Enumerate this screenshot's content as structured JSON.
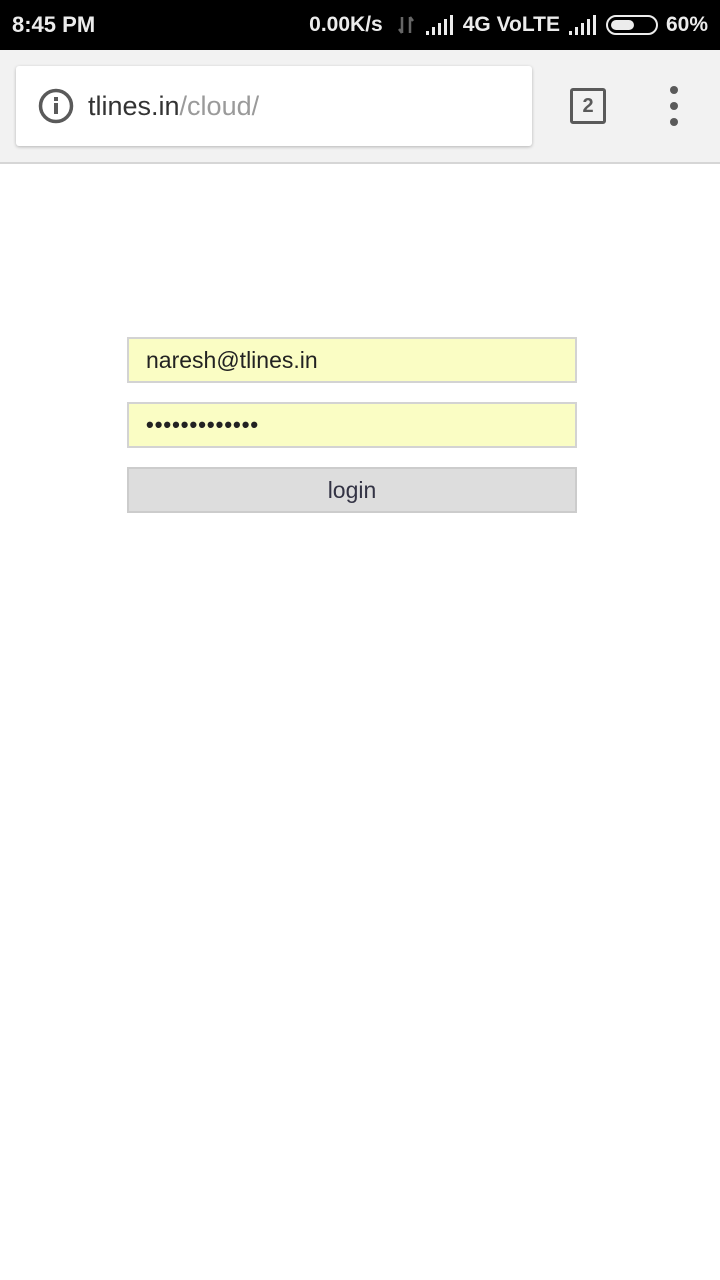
{
  "status_bar": {
    "time": "8:45 PM",
    "net_speed": "0.00K/s",
    "network_type": "4G VoLTE",
    "battery_percent_label": "60%",
    "battery_level": 0.6,
    "icons": [
      "data-arrows-icon",
      "signal-icon",
      "battery-icon"
    ]
  },
  "browser": {
    "url_host": "tlines.in",
    "url_path": "/cloud/",
    "tab_count": "2",
    "icons": [
      "info-icon",
      "tabs-icon",
      "overflow-menu-icon"
    ]
  },
  "login": {
    "email_value": "naresh@tlines.in",
    "password_mask": "•••••••••••••",
    "login_label": "login"
  },
  "colors": {
    "status_bar_bg": "#000000",
    "toolbar_bg": "#f2f2f2",
    "autofill_bg": "#fafdc4",
    "button_bg": "#dddddd"
  }
}
